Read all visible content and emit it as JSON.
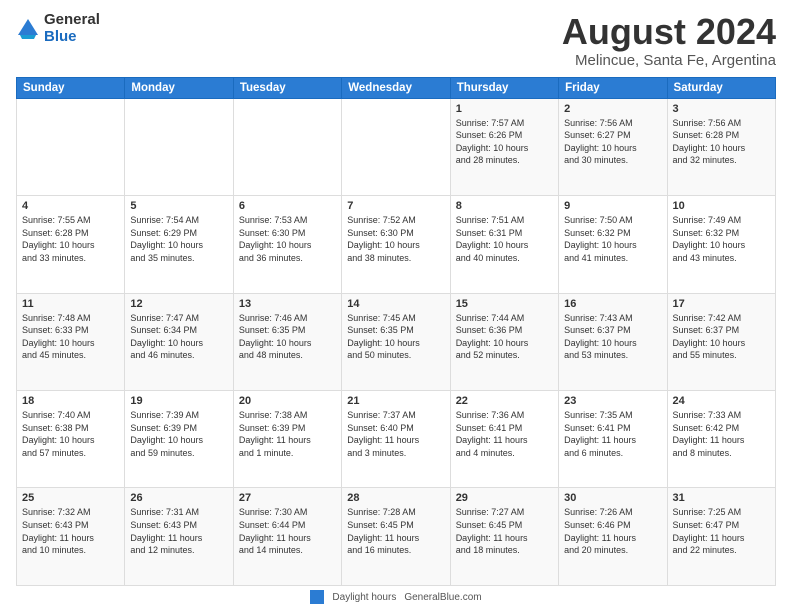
{
  "header": {
    "logo_general": "General",
    "logo_blue": "Blue",
    "title": "August 2024",
    "location": "Melincue, Santa Fe, Argentina"
  },
  "days_of_week": [
    "Sunday",
    "Monday",
    "Tuesday",
    "Wednesday",
    "Thursday",
    "Friday",
    "Saturday"
  ],
  "weeks": [
    [
      {
        "day": "",
        "info": ""
      },
      {
        "day": "",
        "info": ""
      },
      {
        "day": "",
        "info": ""
      },
      {
        "day": "",
        "info": ""
      },
      {
        "day": "1",
        "info": "Sunrise: 7:57 AM\nSunset: 6:26 PM\nDaylight: 10 hours\nand 28 minutes."
      },
      {
        "day": "2",
        "info": "Sunrise: 7:56 AM\nSunset: 6:27 PM\nDaylight: 10 hours\nand 30 minutes."
      },
      {
        "day": "3",
        "info": "Sunrise: 7:56 AM\nSunset: 6:28 PM\nDaylight: 10 hours\nand 32 minutes."
      }
    ],
    [
      {
        "day": "4",
        "info": "Sunrise: 7:55 AM\nSunset: 6:28 PM\nDaylight: 10 hours\nand 33 minutes."
      },
      {
        "day": "5",
        "info": "Sunrise: 7:54 AM\nSunset: 6:29 PM\nDaylight: 10 hours\nand 35 minutes."
      },
      {
        "day": "6",
        "info": "Sunrise: 7:53 AM\nSunset: 6:30 PM\nDaylight: 10 hours\nand 36 minutes."
      },
      {
        "day": "7",
        "info": "Sunrise: 7:52 AM\nSunset: 6:30 PM\nDaylight: 10 hours\nand 38 minutes."
      },
      {
        "day": "8",
        "info": "Sunrise: 7:51 AM\nSunset: 6:31 PM\nDaylight: 10 hours\nand 40 minutes."
      },
      {
        "day": "9",
        "info": "Sunrise: 7:50 AM\nSunset: 6:32 PM\nDaylight: 10 hours\nand 41 minutes."
      },
      {
        "day": "10",
        "info": "Sunrise: 7:49 AM\nSunset: 6:32 PM\nDaylight: 10 hours\nand 43 minutes."
      }
    ],
    [
      {
        "day": "11",
        "info": "Sunrise: 7:48 AM\nSunset: 6:33 PM\nDaylight: 10 hours\nand 45 minutes."
      },
      {
        "day": "12",
        "info": "Sunrise: 7:47 AM\nSunset: 6:34 PM\nDaylight: 10 hours\nand 46 minutes."
      },
      {
        "day": "13",
        "info": "Sunrise: 7:46 AM\nSunset: 6:35 PM\nDaylight: 10 hours\nand 48 minutes."
      },
      {
        "day": "14",
        "info": "Sunrise: 7:45 AM\nSunset: 6:35 PM\nDaylight: 10 hours\nand 50 minutes."
      },
      {
        "day": "15",
        "info": "Sunrise: 7:44 AM\nSunset: 6:36 PM\nDaylight: 10 hours\nand 52 minutes."
      },
      {
        "day": "16",
        "info": "Sunrise: 7:43 AM\nSunset: 6:37 PM\nDaylight: 10 hours\nand 53 minutes."
      },
      {
        "day": "17",
        "info": "Sunrise: 7:42 AM\nSunset: 6:37 PM\nDaylight: 10 hours\nand 55 minutes."
      }
    ],
    [
      {
        "day": "18",
        "info": "Sunrise: 7:40 AM\nSunset: 6:38 PM\nDaylight: 10 hours\nand 57 minutes."
      },
      {
        "day": "19",
        "info": "Sunrise: 7:39 AM\nSunset: 6:39 PM\nDaylight: 10 hours\nand 59 minutes."
      },
      {
        "day": "20",
        "info": "Sunrise: 7:38 AM\nSunset: 6:39 PM\nDaylight: 11 hours\nand 1 minute."
      },
      {
        "day": "21",
        "info": "Sunrise: 7:37 AM\nSunset: 6:40 PM\nDaylight: 11 hours\nand 3 minutes."
      },
      {
        "day": "22",
        "info": "Sunrise: 7:36 AM\nSunset: 6:41 PM\nDaylight: 11 hours\nand 4 minutes."
      },
      {
        "day": "23",
        "info": "Sunrise: 7:35 AM\nSunset: 6:41 PM\nDaylight: 11 hours\nand 6 minutes."
      },
      {
        "day": "24",
        "info": "Sunrise: 7:33 AM\nSunset: 6:42 PM\nDaylight: 11 hours\nand 8 minutes."
      }
    ],
    [
      {
        "day": "25",
        "info": "Sunrise: 7:32 AM\nSunset: 6:43 PM\nDaylight: 11 hours\nand 10 minutes."
      },
      {
        "day": "26",
        "info": "Sunrise: 7:31 AM\nSunset: 6:43 PM\nDaylight: 11 hours\nand 12 minutes."
      },
      {
        "day": "27",
        "info": "Sunrise: 7:30 AM\nSunset: 6:44 PM\nDaylight: 11 hours\nand 14 minutes."
      },
      {
        "day": "28",
        "info": "Sunrise: 7:28 AM\nSunset: 6:45 PM\nDaylight: 11 hours\nand 16 minutes."
      },
      {
        "day": "29",
        "info": "Sunrise: 7:27 AM\nSunset: 6:45 PM\nDaylight: 11 hours\nand 18 minutes."
      },
      {
        "day": "30",
        "info": "Sunrise: 7:26 AM\nSunset: 6:46 PM\nDaylight: 11 hours\nand 20 minutes."
      },
      {
        "day": "31",
        "info": "Sunrise: 7:25 AM\nSunset: 6:47 PM\nDaylight: 11 hours\nand 22 minutes."
      }
    ]
  ],
  "footer": {
    "legend_label": "Daylight hours",
    "source": "GeneralBlue.com"
  }
}
